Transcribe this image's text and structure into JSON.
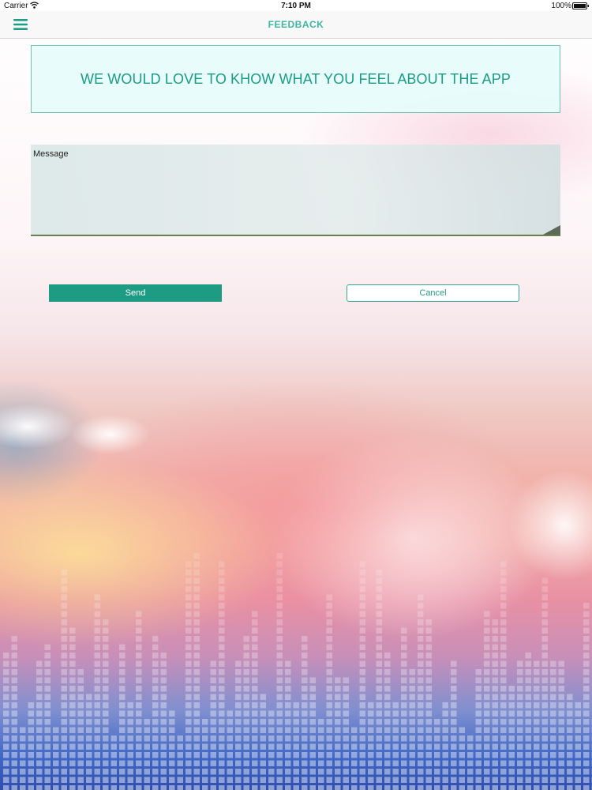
{
  "status_bar": {
    "carrier": "Carrier",
    "time": "7:10 PM",
    "battery": "100%"
  },
  "nav": {
    "title": "FEEDBACK",
    "menu_icon": "hamburger-menu-icon"
  },
  "banner": {
    "text": "WE WOULD LOVE TO KHOW WHAT YOU FEEL ABOUT THE APP"
  },
  "form": {
    "message_label": "Message",
    "message_value": "",
    "send_label": "Send",
    "cancel_label": "Cancel"
  },
  "colors": {
    "accent": "#1d9c83",
    "title": "#3db6a0",
    "banner_text": "#1a9c83",
    "banner_bg": "#e6fcfb",
    "cancel_text": "#2a9a84",
    "cancel_border": "#3aa88f"
  }
}
